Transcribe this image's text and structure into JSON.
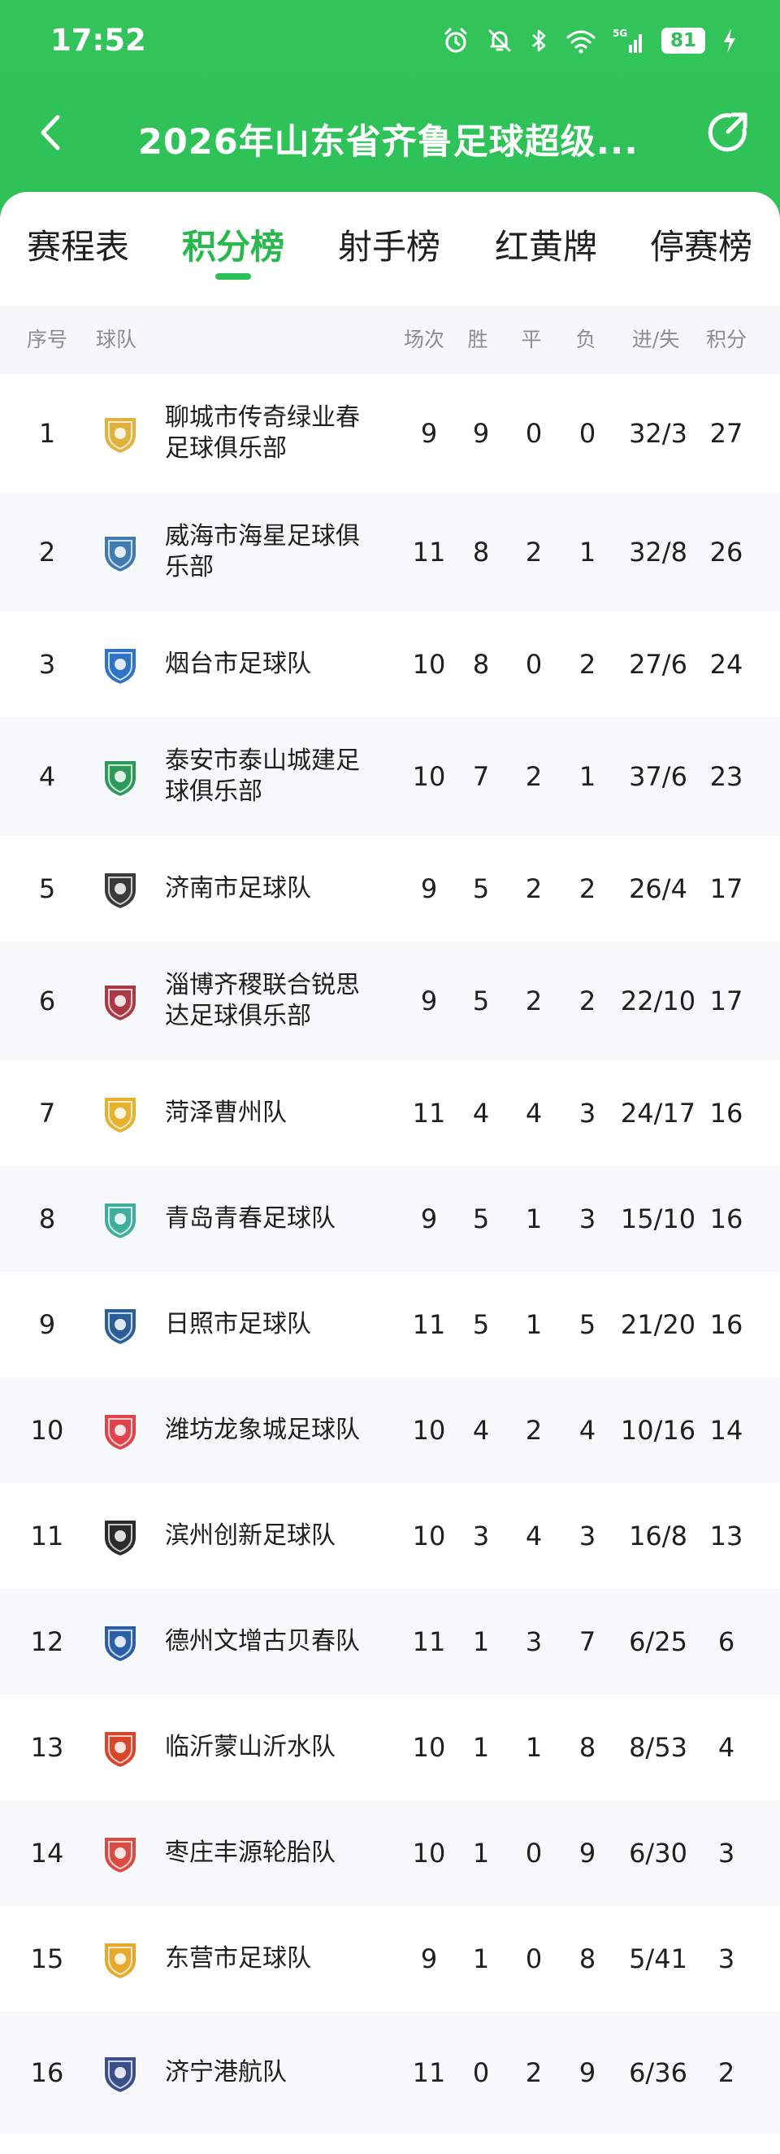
{
  "status_bar": {
    "time": "17:52",
    "network": "5G",
    "battery": "81",
    "icons": [
      "alarm-icon",
      "mute-icon",
      "bluetooth-icon",
      "wifi-icon",
      "signal-icon",
      "battery-icon",
      "charging-icon"
    ]
  },
  "nav": {
    "title": "2026年山东省齐鲁足球超级...",
    "back_icon": "back-arrow-icon",
    "share_icon": "share-icon"
  },
  "tabs": [
    {
      "label": "赛程表",
      "active": false
    },
    {
      "label": "积分榜",
      "active": true
    },
    {
      "label": "射手榜",
      "active": false
    },
    {
      "label": "红黄牌",
      "active": false
    },
    {
      "label": "停赛榜",
      "active": false
    }
  ],
  "table": {
    "headers": {
      "rank": "序号",
      "team": "球队",
      "played": "场次",
      "win": "胜",
      "draw": "平",
      "loss": "负",
      "goals": "进/失",
      "points": "积分"
    },
    "rows": [
      {
        "rank": "1",
        "team": "聊城市传奇绿业春足球俱乐部",
        "played": "9",
        "win": "9",
        "draw": "0",
        "loss": "0",
        "goals": "32/3",
        "points": "27",
        "logo_color": "#e2b33c"
      },
      {
        "rank": "2",
        "team": "威海市海星足球俱乐部",
        "played": "11",
        "win": "8",
        "draw": "2",
        "loss": "1",
        "goals": "32/8",
        "points": "26",
        "logo_color": "#3f7ab0"
      },
      {
        "rank": "3",
        "team": "烟台市足球队",
        "played": "10",
        "win": "8",
        "draw": "0",
        "loss": "2",
        "goals": "27/6",
        "points": "24",
        "logo_color": "#2f73c6"
      },
      {
        "rank": "4",
        "team": "泰安市泰山城建足球俱乐部",
        "played": "10",
        "win": "7",
        "draw": "2",
        "loss": "1",
        "goals": "37/6",
        "points": "23",
        "logo_color": "#2d9a5a"
      },
      {
        "rank": "5",
        "team": "济南市足球队",
        "played": "9",
        "win": "5",
        "draw": "2",
        "loss": "2",
        "goals": "26/4",
        "points": "17",
        "logo_color": "#3a3a3a"
      },
      {
        "rank": "6",
        "team": "淄博齐稷联合锐思达足球俱乐部",
        "played": "9",
        "win": "5",
        "draw": "2",
        "loss": "2",
        "goals": "22/10",
        "points": "17",
        "logo_color": "#a93a45"
      },
      {
        "rank": "7",
        "team": "菏泽曹州队",
        "played": "11",
        "win": "4",
        "draw": "4",
        "loss": "3",
        "goals": "24/17",
        "points": "16",
        "logo_color": "#e7b32e"
      },
      {
        "rank": "8",
        "team": "青岛青春足球队",
        "played": "9",
        "win": "5",
        "draw": "1",
        "loss": "3",
        "goals": "15/10",
        "points": "16",
        "logo_color": "#3fae9a"
      },
      {
        "rank": "9",
        "team": "日照市足球队",
        "played": "11",
        "win": "5",
        "draw": "1",
        "loss": "5",
        "goals": "21/20",
        "points": "16",
        "logo_color": "#2c5f95"
      },
      {
        "rank": "10",
        "team": "潍坊龙象城足球队",
        "played": "10",
        "win": "4",
        "draw": "2",
        "loss": "4",
        "goals": "10/16",
        "points": "14",
        "logo_color": "#e0434b"
      },
      {
        "rank": "11",
        "team": "滨州创新足球队",
        "played": "10",
        "win": "3",
        "draw": "4",
        "loss": "3",
        "goals": "16/8",
        "points": "13",
        "logo_color": "#2b2b2b"
      },
      {
        "rank": "12",
        "team": "德州文增古贝春队",
        "played": "11",
        "win": "1",
        "draw": "3",
        "loss": "7",
        "goals": "6/25",
        "points": "6",
        "logo_color": "#2b5fa8"
      },
      {
        "rank": "13",
        "team": "临沂蒙山沂水队",
        "played": "10",
        "win": "1",
        "draw": "1",
        "loss": "8",
        "goals": "8/53",
        "points": "4",
        "logo_color": "#d9472b"
      },
      {
        "rank": "14",
        "team": "枣庄丰源轮胎队",
        "played": "10",
        "win": "1",
        "draw": "0",
        "loss": "9",
        "goals": "6/30",
        "points": "3",
        "logo_color": "#d94c43"
      },
      {
        "rank": "15",
        "team": "东营市足球队",
        "played": "9",
        "win": "1",
        "draw": "0",
        "loss": "8",
        "goals": "5/41",
        "points": "3",
        "logo_color": "#e6a92b"
      },
      {
        "rank": "16",
        "team": "济宁港航队",
        "played": "11",
        "win": "0",
        "draw": "2",
        "loss": "9",
        "goals": "6/36",
        "points": "2",
        "logo_color": "#3d4f8a"
      }
    ]
  },
  "colors": {
    "brand_green": "#2cc057",
    "active_tab": "#29b84e",
    "header_text": "#8a8d92",
    "row_alt": "#f7f8f9"
  }
}
